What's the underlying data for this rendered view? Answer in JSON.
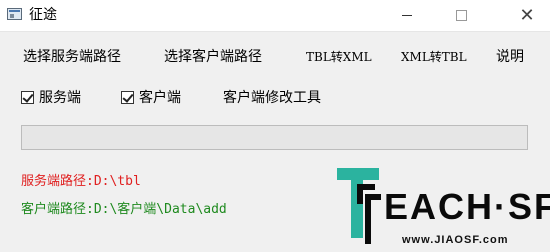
{
  "window": {
    "title": "征途",
    "controls": {
      "minimize": "minimize",
      "maximize": "maximize",
      "close": "✕"
    }
  },
  "toolbar": {
    "select_server_path": "选择服务端路径",
    "select_client_path": "选择客户端路径",
    "tbl_to_xml": "TBL转XML",
    "xml_to_tbl": "XML转TBL",
    "help": "说明"
  },
  "options": {
    "server_checkbox": {
      "label": "服务端",
      "checked": true
    },
    "client_checkbox": {
      "label": "客户端",
      "checked": true
    },
    "client_modify_tool": "客户端修改工具"
  },
  "progress": {
    "value_percent": 0
  },
  "paths": {
    "server": "服务端路径:D:\\tbl",
    "client": "客户端路径:D:\\客户端\\Data\\add"
  },
  "watermark": {
    "brand": "EACH·SF",
    "url": "www.JIAOSF.com",
    "colors": {
      "teal": "#2bb39f",
      "dark": "#0a0a0a"
    }
  },
  "colors": {
    "server_path": "#e02020",
    "client_path": "#1f8a1f"
  }
}
